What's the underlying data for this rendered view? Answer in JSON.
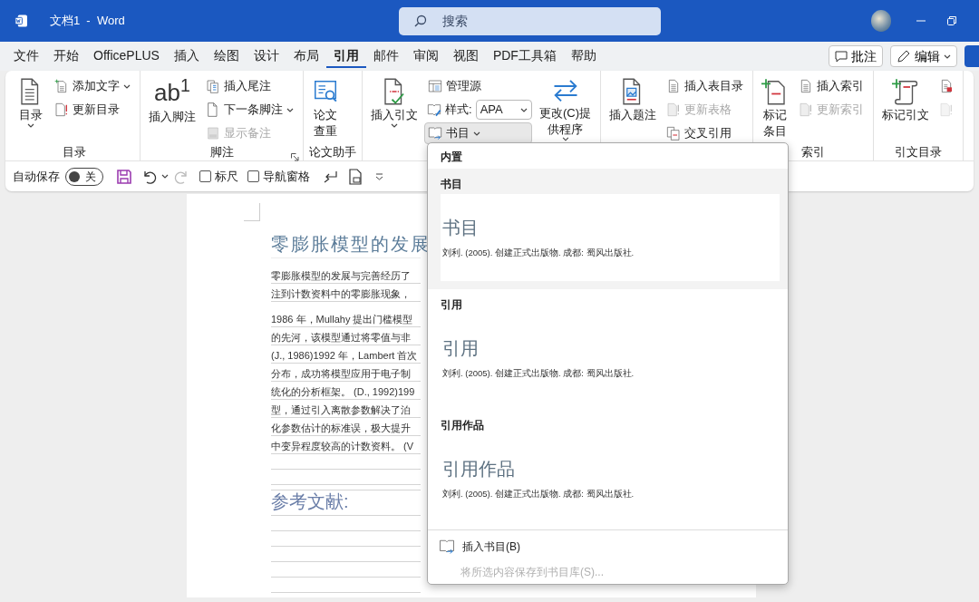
{
  "window": {
    "title": "文档1  -  Word",
    "search": {
      "placeholder": "搜索"
    }
  },
  "tabs": [
    {
      "label": "文件",
      "selected": false
    },
    {
      "label": "开始",
      "selected": false
    },
    {
      "label": "OfficePLUS",
      "selected": false
    },
    {
      "label": "插入",
      "selected": false
    },
    {
      "label": "绘图",
      "selected": false
    },
    {
      "label": "设计",
      "selected": false
    },
    {
      "label": "布局",
      "selected": false
    },
    {
      "label": "引用",
      "selected": true
    },
    {
      "label": "邮件",
      "selected": false
    },
    {
      "label": "审阅",
      "selected": false
    },
    {
      "label": "视图",
      "selected": false
    },
    {
      "label": "PDF工具箱",
      "selected": false
    },
    {
      "label": "帮助",
      "selected": false
    }
  ],
  "tab_actions": [
    {
      "kind": "comment",
      "label": "批注"
    },
    {
      "kind": "editing",
      "label": "编辑"
    },
    {
      "kind": "share"
    }
  ],
  "ribbon": {
    "groups": [
      {
        "label": "目录",
        "columns": [
          [
            {
              "kind": "large",
              "label": "目录",
              "caret": true
            }
          ],
          [
            {
              "kind": "small",
              "label": "添加文字",
              "caret": true
            },
            {
              "kind": "small",
              "label": "更新目录"
            }
          ]
        ]
      },
      {
        "label": "脚注",
        "launcher": true,
        "columns": [
          [
            {
              "kind": "large",
              "label": "插入脚注",
              "glyph": "ab$^{1}$"
            }
          ],
          [
            {
              "kind": "small",
              "label": "插入尾注"
            },
            {
              "kind": "small",
              "label": "下一条脚注",
              "caret": true
            },
            {
              "kind": "small",
              "label": "显示备注",
              "disabled": true
            }
          ]
        ]
      },
      {
        "label": "论文助手",
        "columns": [
          [
            {
              "kind": "large",
              "label": "论文查重"
            }
          ]
        ]
      },
      {
        "columns": [
          [
            {
              "kind": "large",
              "label": "插入引文",
              "caret": true
            }
          ],
          [
            {
              "kind": "small",
              "label": "管理源"
            },
            {
              "kind": "select",
              "label": "样式:",
              "value": "APA"
            },
            {
              "kind": "small",
              "label": "书目",
              "caret": true,
              "selected": true
            }
          ],
          [
            {
              "kind": "large",
              "label": "更改(C)提供程序",
              "caret": true
            }
          ]
        ]
      },
      {
        "columns": [
          [
            {
              "kind": "large",
              "label": "插入题注"
            }
          ],
          [
            {
              "kind": "small",
              "label": "插入表目录"
            },
            {
              "kind": "small",
              "label": "更新表格",
              "disabled": true
            },
            {
              "kind": "small",
              "label": "交叉引用"
            }
          ]
        ]
      },
      {
        "label": "索引",
        "columns": [
          [
            {
              "kind": "large",
              "label": "标记条目"
            }
          ],
          [
            {
              "kind": "small",
              "label": "插入索引"
            },
            {
              "kind": "small",
              "label": "更新索引",
              "disabled": true
            }
          ]
        ]
      },
      {
        "label": "引文目录",
        "columns": [
          [
            {
              "kind": "large",
              "label": "标记引文"
            }
          ],
          [
            {
              "kind": "icon"
            },
            {
              "kind": "icon",
              "disabled": true
            }
          ]
        ]
      }
    ]
  },
  "quick_access": [
    {
      "kind": "toggle",
      "label": "自动保存",
      "on": false,
      "state_text": "关"
    },
    {
      "kind": "save"
    },
    {
      "kind": "undo",
      "caret": true
    },
    {
      "kind": "redo",
      "disabled": true
    },
    {
      "kind": "checkbox",
      "label": "标尺",
      "checked": false
    },
    {
      "kind": "checkbox",
      "label": "导航窗格",
      "checked": false
    },
    {
      "kind": "enter"
    },
    {
      "kind": "preview"
    },
    {
      "kind": "more"
    }
  ],
  "document": {
    "heading": "零膨胀模型的发展",
    "paragraphs": [
      [
        "零膨胀模型的发展与完善经历了",
        "注到计数资料中的零膨胀现象，"
      ],
      [
        "1986 年，Mullahy 提出门槛模型",
        "的先河，该模型通过将零值与非",
        "(J., 1986)1992 年，Lambert 首次",
        "分布，成功将模型应用于电子制",
        "统化的分析框架。 (D., 1992)199",
        "型，通过引入离散参数解决了泊",
        "化参数估计的标准误，极大提升",
        "中变异程度较高的计数资料。 (V"
      ]
    ],
    "references_heading": "参考文献:"
  },
  "bibliography_menu": {
    "header": "内置",
    "options": [
      {
        "title": "书目",
        "preview_heading": "书目",
        "entry": "刘利. (2005). 创建正式出版物. 成都: 蜀风出版社.",
        "selected": true
      },
      {
        "title": "引用",
        "preview_heading": "引用",
        "entry": "刘利. (2005). 创建正式出版物. 成都: 蜀风出版社.",
        "selected": false
      },
      {
        "title": "引用作品",
        "preview_heading": "引用作品",
        "entry": "刘利. (2005). 创建正式出版物. 成都: 蜀风出版社.",
        "selected": false
      }
    ],
    "actions": [
      {
        "label": "插入书目(B)",
        "disabled": false,
        "kind": "insert"
      },
      {
        "label": "将所选内容保存到书目库(S)...",
        "disabled": true,
        "kind": "save"
      }
    ]
  }
}
